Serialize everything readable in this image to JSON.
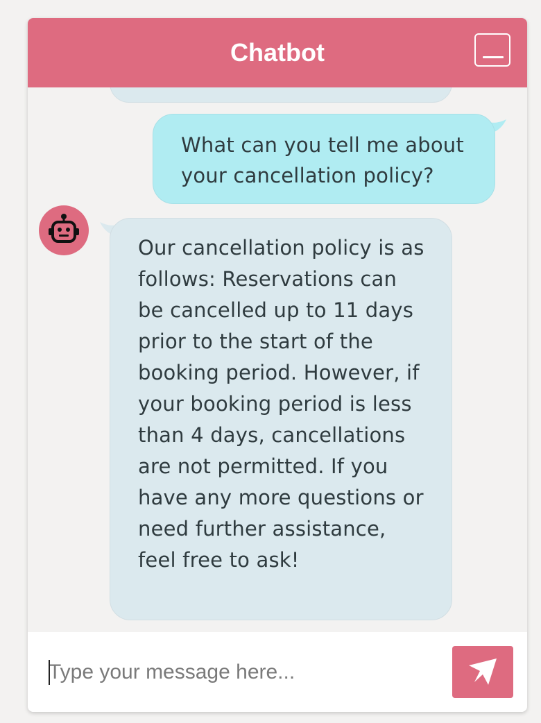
{
  "header": {
    "title": "Chatbot",
    "minimize_icon": "minimize-icon"
  },
  "messages": [
    {
      "sender": "user",
      "text": "What can you tell me about your cancellation policy?"
    },
    {
      "sender": "bot",
      "avatar_icon": "robot-icon",
      "text": "Our cancellation policy is as follows: Reservations can be cancelled up to 11 days prior to the start of the booking period. However, if your booking period is less than 4 days, cancellations are not permitted. If you have any more questions or need further assistance, feel free to ask!"
    }
  ],
  "input": {
    "placeholder": "Type your message here...",
    "value": "",
    "send_icon": "send-icon"
  },
  "colors": {
    "accent": "#de6b80",
    "user_bubble": "#b0ecf2",
    "bot_bubble": "#dbe9ee",
    "background": "#f3f2f1"
  }
}
